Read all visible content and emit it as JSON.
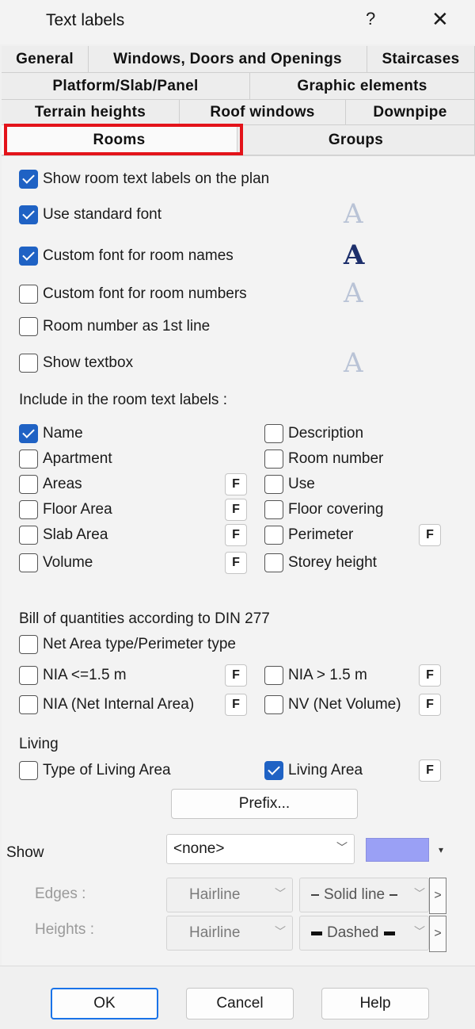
{
  "window": {
    "title": "Text labels",
    "help": "?",
    "close": "✕"
  },
  "tabs": {
    "general": "General",
    "windows": "Windows, Doors and Openings",
    "staircases": "Staircases",
    "platform": "Platform/Slab/Panel",
    "graphic": "Graphic elements",
    "terrain": "Terrain heights",
    "roofwin": "Roof windows",
    "downpipe": "Downpipe",
    "rooms": "Rooms",
    "groups": "Groups"
  },
  "options": {
    "show_labels": {
      "label": "Show room text labels on the plan",
      "checked": true
    },
    "std_font": {
      "label": "Use standard font",
      "checked": true
    },
    "custom_names": {
      "label": "Custom font for room names",
      "checked": true
    },
    "custom_numbers": {
      "label": "Custom font for room numbers",
      "checked": false
    },
    "number_first": {
      "label": "Room number as 1st line",
      "checked": false
    },
    "textbox": {
      "label": "Show textbox",
      "checked": false
    },
    "font_glyph": "A"
  },
  "include": {
    "heading": "Include in the room text labels :",
    "name": "Name",
    "apartment": "Apartment",
    "areas": "Areas",
    "floor_area": "Floor Area",
    "slab_area": "Slab Area",
    "volume": "Volume",
    "description": "Description",
    "room_number": "Room number",
    "use": "Use",
    "floor_covering": "Floor covering",
    "perimeter": "Perimeter",
    "storey_height": "Storey height",
    "f": "F"
  },
  "bill": {
    "heading": "Bill of quantities according to DIN 277",
    "net_area_type": "Net Area type/Perimeter type",
    "nia_le": "NIA <=1.5 m",
    "nia_gt": "NIA > 1.5 m",
    "nia": "NIA (Net Internal Area)",
    "nv": "NV (Net Volume)"
  },
  "living": {
    "heading": "Living",
    "type": "Type of Living Area",
    "area": "Living Area",
    "prefix": "Prefix..."
  },
  "show": {
    "label": "Show",
    "value": "<none>",
    "color": "#9aa0f5",
    "edges_label": "Edges :",
    "heights_label": "Heights :",
    "edges_weight": "Hairline",
    "edges_line": "Solid line",
    "heights_weight": "Hairline",
    "heights_line": "Dashed"
  },
  "footer": {
    "ok": "OK",
    "cancel": "Cancel",
    "help": "Help"
  }
}
